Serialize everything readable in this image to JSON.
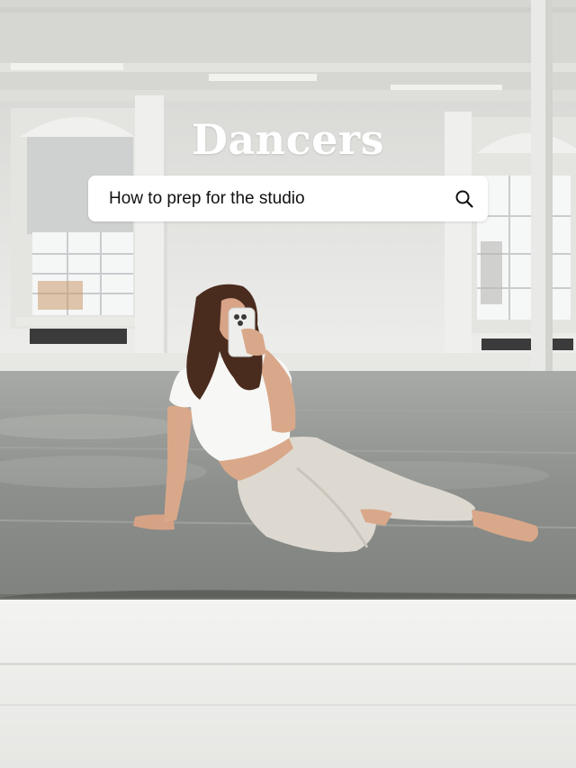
{
  "title": "Dancers",
  "search": {
    "query": "How to prep for the studio",
    "icon": "search-icon"
  },
  "colors": {
    "wall": "#e9e9e6",
    "floor": "#8e918d",
    "shirt": "#f7f7f5",
    "pants": "#dcdad3",
    "hair": "#4a2c1f",
    "skin": "#d9a88a"
  }
}
